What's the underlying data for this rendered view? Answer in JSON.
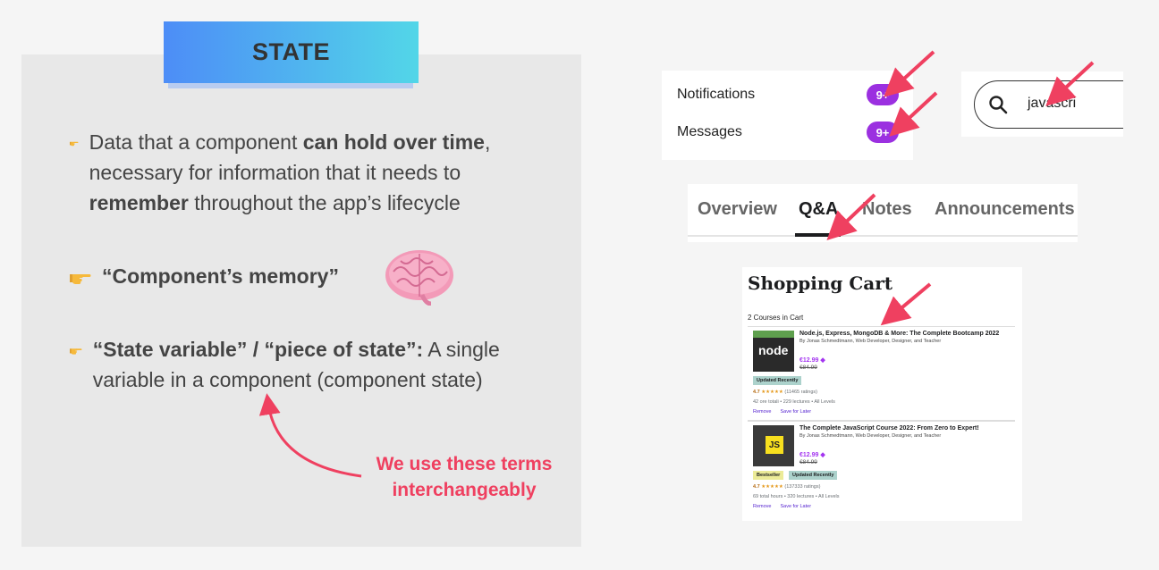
{
  "slide": {
    "title": "STATE",
    "bullets": {
      "b1": {
        "pre": "Data that a component ",
        "bold1": "can hold over time",
        "mid": ", necessary for information that it needs to ",
        "bold2": "remember",
        "post": " throughout the app’s lifecycle"
      },
      "b2": {
        "bold": "“Component’s memory”"
      },
      "b3": {
        "bold": "“State variable” / “piece of state”:",
        "post": " A single variable in a component (component state)"
      }
    },
    "note_line1": "We use these terms",
    "note_line2": "interchangeably",
    "colors": {
      "accent": "#ef4060",
      "title_gradient_start": "#4d8df7",
      "title_gradient_end": "#52d6e8",
      "badge": "#9b30e0",
      "price": "#a435f0"
    },
    "icons": [
      "pointing-hand-icon",
      "brain-icon",
      "arrow-icon"
    ]
  },
  "examples": {
    "notifications": {
      "rows": [
        {
          "label": "Notifications",
          "badge": "9+"
        },
        {
          "label": "Messages",
          "badge": "9+"
        }
      ]
    },
    "search": {
      "value": "javascri",
      "icon": "search-icon"
    },
    "tabs": {
      "items": [
        "Overview",
        "Q&A",
        "Notes",
        "Announcements"
      ],
      "active": "Q&A"
    },
    "cart": {
      "title": "Shopping Cart",
      "count": "2 Courses in Cart",
      "items": [
        {
          "thumb_text": "node",
          "title": "Node.js, Express, MongoDB & More: The Complete Bootcamp 2022",
          "author": "By Jonas Schmedtmann, Web Developer, Designer, and Teacher",
          "price": "€12.99",
          "old_price": "€84.99",
          "tag1": "Updated Recently",
          "rating": "4.7",
          "stars": "★★★★★",
          "ratings": "(11465 ratings)",
          "meta": "42 ore totali • 229 lectures • All Levels",
          "remove": "Remove",
          "save": "Save for Later"
        },
        {
          "thumb_text": "JS",
          "title": "The Complete JavaScript Course 2022: From Zero to Expert!",
          "author": "By Jonas Schmedtmann, Web Developer, Designer, and Teacher",
          "price": "€12.99",
          "old_price": "€84.99",
          "tag1": "Bestseller",
          "tag2": "Updated Recently",
          "rating": "4.7",
          "stars": "★★★★★",
          "ratings": "(137333 ratings)",
          "meta": "69 total hours • 320 lectures • All Levels",
          "remove": "Remove",
          "save": "Save for Later"
        }
      ]
    }
  }
}
